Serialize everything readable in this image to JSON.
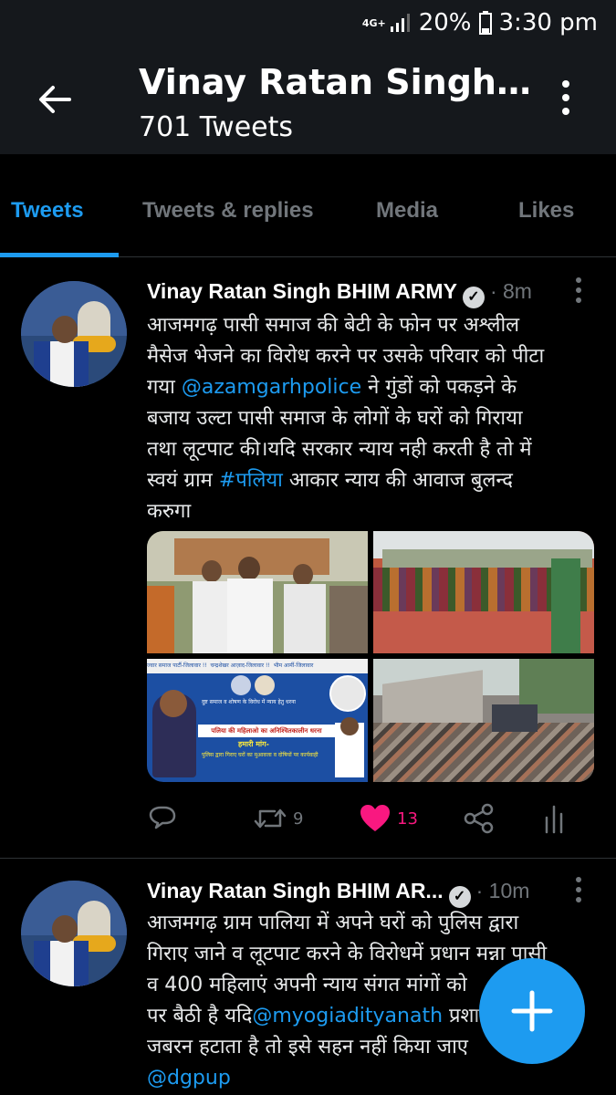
{
  "status_bar": {
    "network": "4G+",
    "battery": "20%",
    "time": "3:30 pm"
  },
  "header": {
    "title": "Vinay Ratan Singh…",
    "subtitle": "701 Tweets"
  },
  "tabs": [
    "Tweets",
    "Tweets & replies",
    "Media",
    "Likes"
  ],
  "tweets": [
    {
      "name": "Vinay Ratan Singh BHIM ARMY",
      "time": "8m",
      "text_lines": [
        "आजमगढ़ पासी समाज की बेटी के फोन पर अश्लील",
        "मैसेज भेजने का विरोध करने पर उसके परिवार को पीटा",
        "गया",
        "ने गुंडों को पकड़ने के",
        "बजाय उल्टा पासी समाज के लोगों के घरों को गिराया",
        "तथा लूटपाट की।यदि सरकार न्याय नही करती है तो में",
        "स्वयं ग्राम",
        "आकार न्याय की आवाज बुलन्द",
        "करुगा"
      ],
      "mention": "@azamgarhpolice",
      "hashtag": "#पलिया",
      "media_banner": {
        "top_left": "ज्वार समाज पार्टी-जिलावार !!",
        "top_mid": "चन्द्रशेखर आज़ाद-जिलावार !!",
        "top_right": "भीम आर्मी-जिलावार",
        "headline": "पलिया की महिलाओ का अनिश्चितकालीन धरना",
        "demand": "हमारी मांग-"
      },
      "retweets": "9",
      "likes": "13"
    },
    {
      "name": "Vinay Ratan Singh BHIM AR...",
      "time": "10m",
      "text_lines": [
        "आजमगढ़ ग्राम पालिया में अपने घरों को पुलिस द्वारा",
        "गिराए जाने व लूटपाट करने के विरोधमें प्रधान मन्ना पासी",
        "व 400 महिलाएं अपनी न्याय संगत मांगों को",
        "पर बैठी है यदि",
        "प्रशा",
        "जबरन हटाता है तो इसे सहन नहीं किया जाए"
      ],
      "mention1": "@myogiadityanath",
      "mention2": "@dgpup"
    }
  ],
  "colors": {
    "accent": "#1d9bf0",
    "like": "#f91880",
    "bg": "#000000",
    "header_bg": "#15181c"
  },
  "icons": [
    "back-arrow-icon",
    "more-vertical-icon",
    "verified-icon",
    "reply-icon",
    "retweet-icon",
    "heart-icon",
    "share-icon",
    "analytics-icon",
    "compose-plus-icon"
  ]
}
